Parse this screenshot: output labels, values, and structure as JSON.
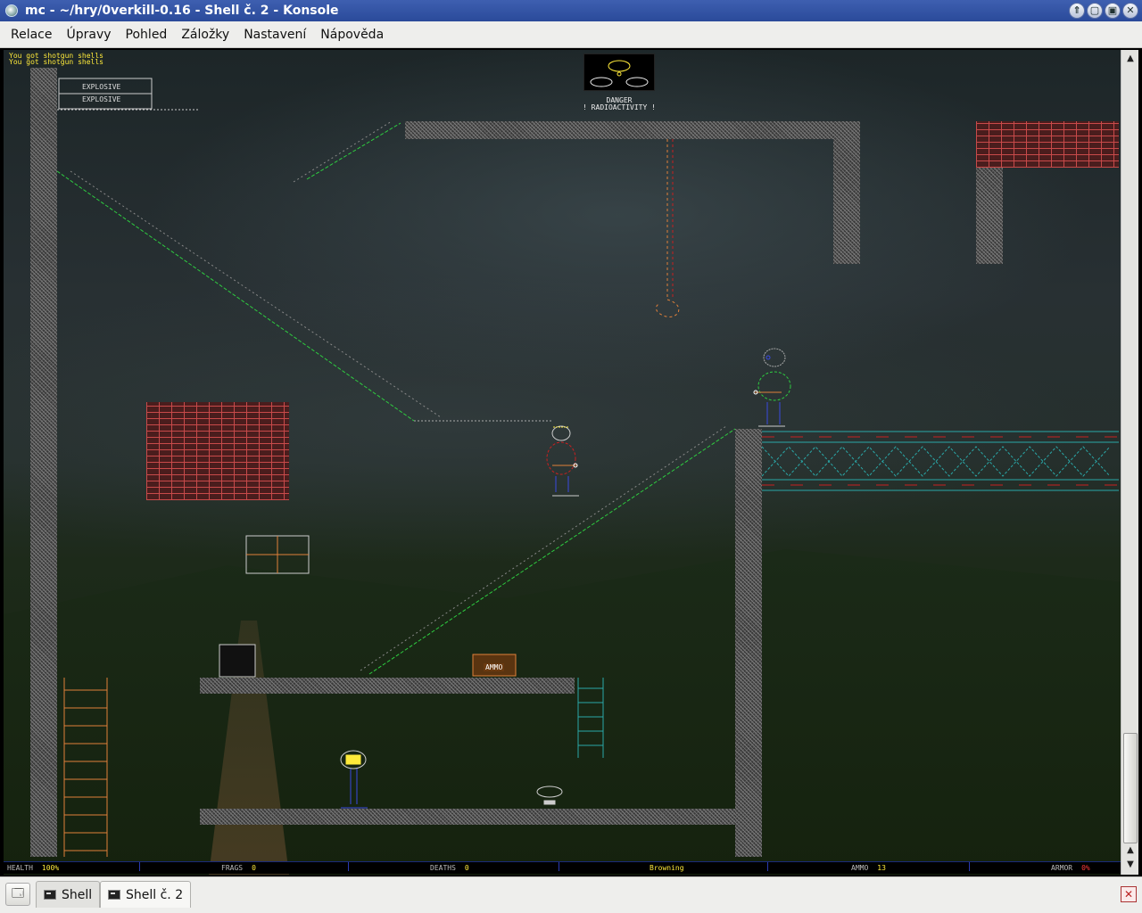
{
  "window": {
    "title": "mc - ~/hry/0verkill-0.16 - Shell č. 2 - Konsole",
    "buttons": [
      "⇑",
      "▢",
      "▣",
      "✕"
    ]
  },
  "menu": [
    "Relace",
    "Úpravy",
    "Pohled",
    "Záložky",
    "Nastavení",
    "Nápověda"
  ],
  "game": {
    "messages": [
      "You got shotgun shells",
      "You got shotgun shells"
    ],
    "sign": {
      "line1": "DANGER",
      "line2": "! RADIOACTIVITY !"
    },
    "crates": [
      "EXPLOSIVE",
      "EXPLOSIVE"
    ],
    "ammo_box": "AMMO"
  },
  "hud": {
    "health_label": "HEALTH",
    "health_value": "100%",
    "frags_label": "FRAGS",
    "frags_value": "0",
    "deaths_label": "DEATHS",
    "deaths_value": "0",
    "weapon": "Browning",
    "ammo_label": "AMMO",
    "ammo_value": "13",
    "armor_label": "ARMOR",
    "armor_value": "0%"
  },
  "tabs": [
    {
      "label": "Shell"
    },
    {
      "label": "Shell č. 2"
    }
  ],
  "colors": {
    "hud_value": "#ffea3a",
    "hud_red": "#ff3a3a",
    "brick": "#c84a4a",
    "stairs": "#2ecc40",
    "titlebar": "#3e5fb0"
  }
}
